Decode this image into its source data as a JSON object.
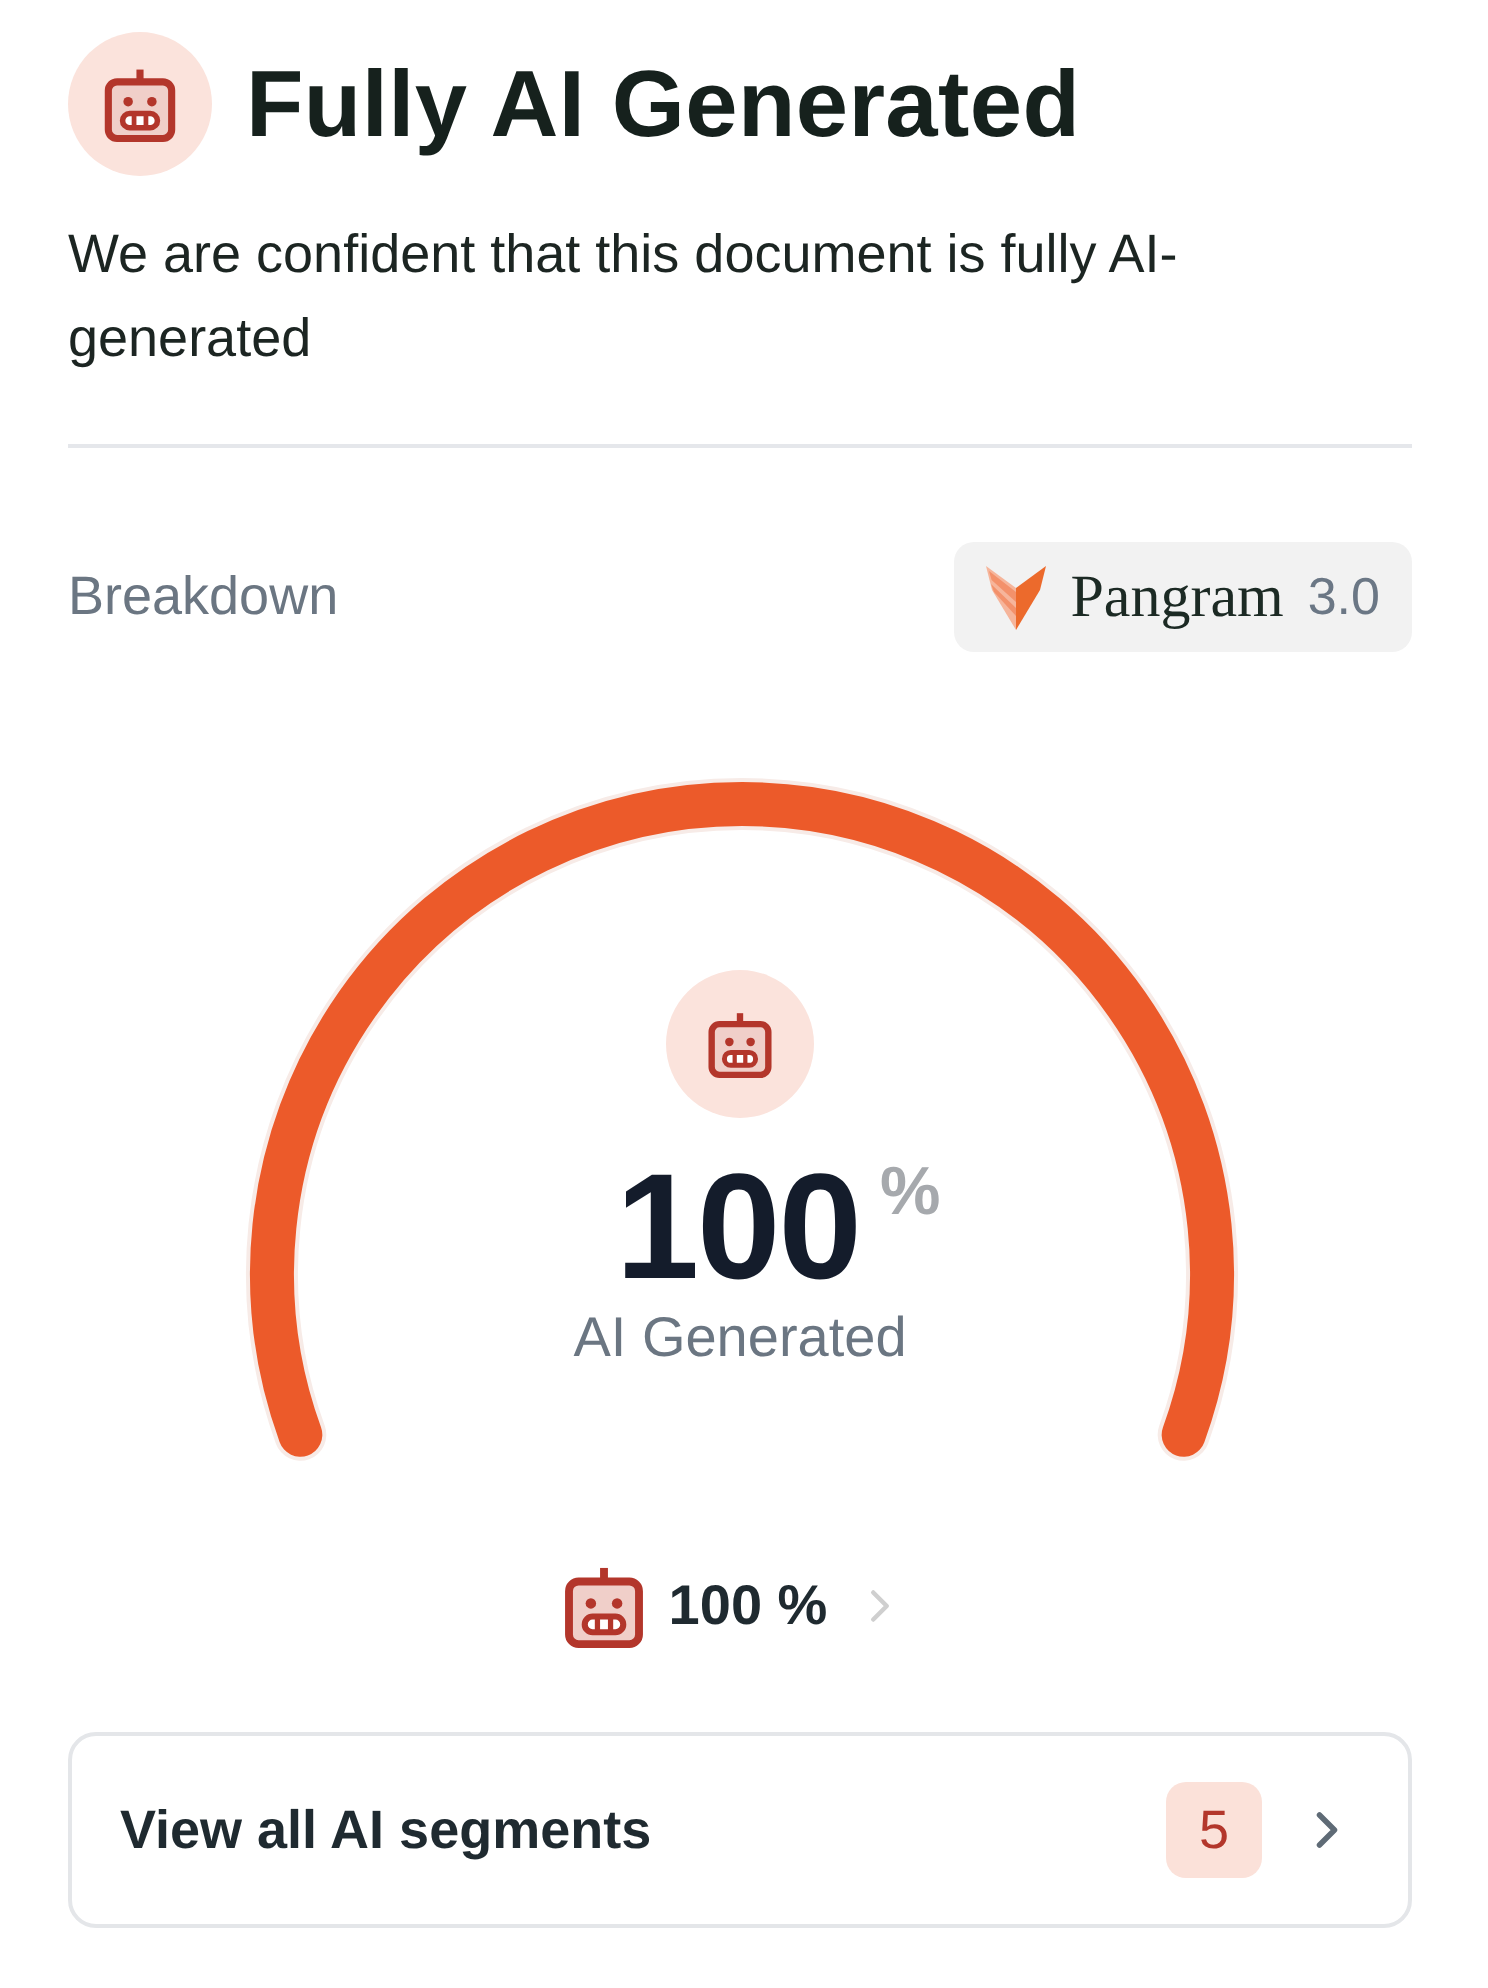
{
  "header": {
    "title": "Fully AI Generated",
    "description": "We are confident that this document is fully AI-generated"
  },
  "breakdown": {
    "label": "Breakdown",
    "model": {
      "name": "Pangram",
      "version": "3.0"
    }
  },
  "gauge": {
    "level": 1,
    "value": "100",
    "unit": "%",
    "caption": "AI Generated"
  },
  "legend": [
    {
      "kind": "ai",
      "value": "100 %"
    }
  ],
  "segments_button": {
    "label": "View all AI segments",
    "count": "5"
  }
}
